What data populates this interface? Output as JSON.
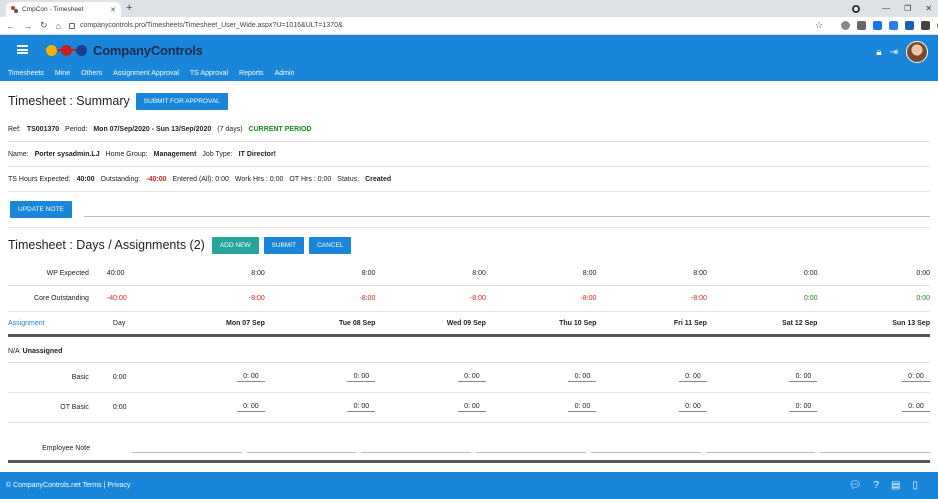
{
  "browser": {
    "tab_title": "CmpCon - Timesheet",
    "url": "companycontrols.pro/Timesheets/Timesheet_User_Wide.aspx?U=1016&ULT=1370&"
  },
  "app": {
    "brand": "CompanyControls",
    "menu": [
      "Timesheets",
      "Mine",
      "Others",
      "Assignment Approval",
      "TS Approval",
      "Reports",
      "Admin"
    ]
  },
  "summary": {
    "title": "Timesheet : Summary",
    "submit_for_approval": "SUBMIT FOR APPROVAL",
    "ref_label": "Ref:",
    "ref": "TS001370",
    "period_label": "Period:",
    "period": "Mon 07/Sep/2020 - Sun 13/Sep/2020",
    "days": "(7 days)",
    "current": "CURRENT PERIOD",
    "name_label": "Name:",
    "name": "Porter sysadmin.LJ",
    "group_label": "Home Group:",
    "group": "Management",
    "job_label": "Job Type:",
    "job": "IT Director!",
    "expected_label": "TS Hours Expected:",
    "expected": "40:00",
    "outstanding_label": "Outstanding:",
    "outstanding": "-40:00",
    "entered": "Entered (All): 0:00",
    "work": "Work Hrs : 0:00",
    "ot": "OT Hrs : 0:00",
    "status_label": "Status:",
    "status": "Created",
    "update_note": "UPDATE NOTE"
  },
  "days": {
    "title": "Timesheet : Days / Assignments (2)",
    "add_new": "ADD NEW",
    "submit": "SUBMIT",
    "cancel": "CANCEL",
    "wp_label": "WP Expected",
    "wp_total": "40:00",
    "wp_values": [
      "8:00",
      "8:00",
      "8:00",
      "8:00",
      "8:00",
      "0:00",
      "0:00"
    ],
    "core_label": "Core Outstanding",
    "core_total": "-40:00",
    "core_values": [
      "-8:00",
      "-8:00",
      "-8:00",
      "-8:00",
      "-8:00",
      "0:00",
      "0:00"
    ],
    "assignment_label": "Assignment",
    "day_label": "Day",
    "day_headers": [
      "Mon 07 Sep",
      "Tue 08 Sep",
      "Wed 09 Sep",
      "Thu 10 Sep",
      "Fri 11 Sep",
      "Sat 12 Sep",
      "Sun 13 Sep"
    ],
    "na_label": "N/A",
    "unassigned": "Unassigned",
    "basic_label": "Basic",
    "basic_total": "0:00",
    "ot_basic_label": "OT Basic",
    "ot_basic_total": "0:00",
    "cell_value": "0: 00",
    "employee_note": "Employee Note"
  },
  "footer": {
    "text": "© CompanyControls.net Terms | Privacy"
  }
}
